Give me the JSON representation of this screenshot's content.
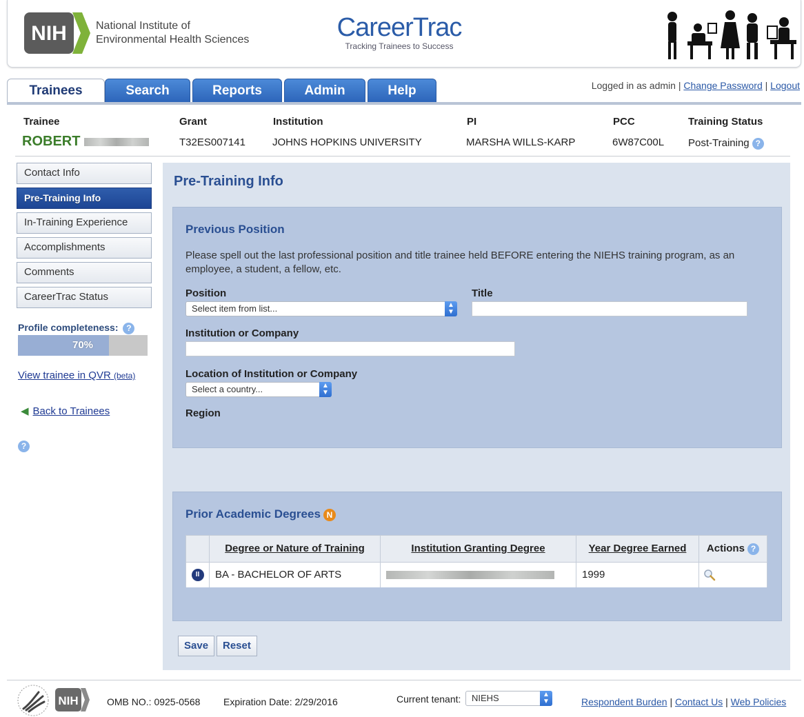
{
  "header": {
    "nih_mark": "NIH",
    "institute_line1": "National Institute of",
    "institute_line2": "Environmental Health Sciences",
    "app_title": "CareerTrac",
    "app_tagline": "Tracking Trainees to Success"
  },
  "tabs": [
    {
      "label": "Trainees",
      "active": true
    },
    {
      "label": "Search",
      "active": false
    },
    {
      "label": "Reports",
      "active": false
    },
    {
      "label": "Admin",
      "active": false
    },
    {
      "label": "Help",
      "active": false
    }
  ],
  "login": {
    "logged_in_text": "Logged in as admin",
    "sep": "|",
    "change_password": "Change Password",
    "logout": "Logout"
  },
  "trainee_bar": {
    "headers": {
      "trainee": "Trainee",
      "grant": "Grant",
      "institution": "Institution",
      "pi": "PI",
      "pcc": "PCC",
      "training_status": "Training Status"
    },
    "values": {
      "trainee": "ROBERT",
      "grant": "T32ES007141",
      "institution": "JOHNS HOPKINS UNIVERSITY",
      "pi": "MARSHA WILLS-KARP",
      "pcc": "6W87C00L",
      "training_status": "Post-Training"
    }
  },
  "sidebar": {
    "items": [
      {
        "label": "Contact Info",
        "active": false
      },
      {
        "label": "Pre-Training Info",
        "active": true
      },
      {
        "label": "In-Training Experience",
        "active": false
      },
      {
        "label": "Accomplishments",
        "active": false
      },
      {
        "label": "Comments",
        "active": false
      },
      {
        "label": "CareerTrac Status",
        "active": false
      }
    ],
    "profile_label": "Profile completeness:",
    "profile_percent": 70,
    "profile_text": "70%",
    "qvr_link": "View trainee in QVR",
    "qvr_beta": "(beta)",
    "back_link": "Back to Trainees"
  },
  "main": {
    "title": "Pre-Training Info",
    "previous_position": {
      "title": "Previous Position",
      "instructions": "Please spell out the last professional position and title trainee held BEFORE entering the NIEHS training program, as an employee, a student, a fellow, etc.",
      "position_label": "Position",
      "position_select": "Select item from list...",
      "title_label": "Title",
      "title_value": "",
      "institution_label": "Institution or Company",
      "institution_value": "",
      "location_label": "Location of Institution or Company",
      "country_select": "Select a country...",
      "region_label": "Region"
    },
    "degrees": {
      "title": "Prior Academic Degrees",
      "badge": "N",
      "columns": [
        "Degree or Nature of Training",
        "Institution Granting Degree",
        "Year Degree Earned",
        "Actions"
      ],
      "rows": [
        {
          "degree": "BA - BACHELOR OF ARTS",
          "institution": "",
          "year": "1999"
        }
      ]
    },
    "buttons": {
      "save": "Save",
      "reset": "Reset"
    }
  },
  "footer": {
    "nih_mark": "NIH",
    "omb": "OMB NO.: 0925-0568",
    "expiration": "Expiration Date: 2/29/2016",
    "tenant_label": "Current tenant:",
    "tenant_value": "NIEHS",
    "links": [
      "Respondent Burden",
      "Contact Us",
      "Web Policies"
    ],
    "sep": "|"
  },
  "colors": {
    "tab_blue": "#2b63b8",
    "nav_active": "#1d4594",
    "panel_bg": "#b6c6e0",
    "main_bg": "#dbe3ee",
    "trainee_green": "#3b7d2a",
    "title_blue": "#2a4f92"
  }
}
